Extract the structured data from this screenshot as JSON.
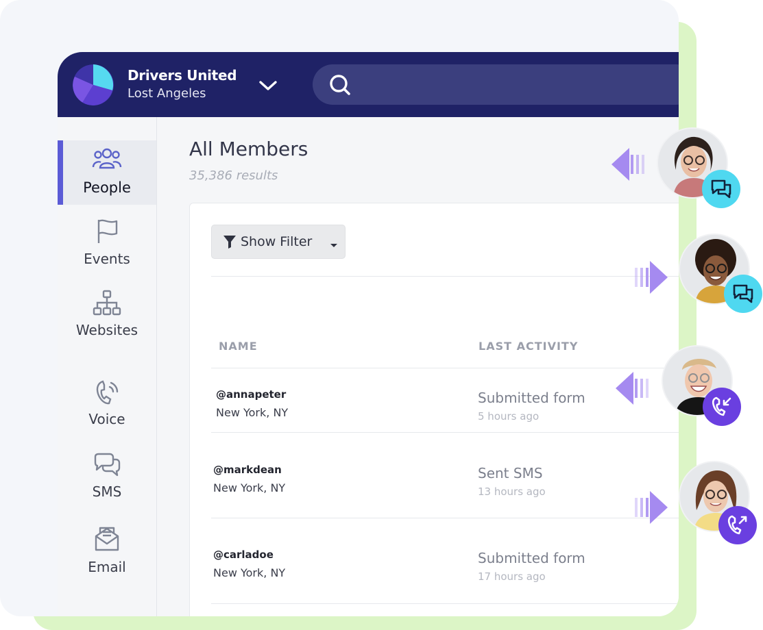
{
  "org": {
    "name": "Drivers United",
    "city": "Lost Angeles"
  },
  "search": {
    "placeholder": ""
  },
  "sidebar": {
    "items": [
      {
        "label": "People",
        "icon": "people-icon",
        "active": true
      },
      {
        "label": "Events",
        "icon": "flag-icon",
        "active": false
      },
      {
        "label": "Websites",
        "icon": "sitemap-icon",
        "active": false
      },
      {
        "label": "Voice",
        "icon": "phone-ringing-icon",
        "active": false
      },
      {
        "label": "SMS",
        "icon": "chat-bubbles-icon",
        "active": false
      },
      {
        "label": "Email",
        "icon": "envelope-icon",
        "active": false
      }
    ]
  },
  "main": {
    "title": "All Members",
    "results": "35,386 results",
    "filter_label": "Show Filter",
    "columns": [
      "NAME",
      "LAST ACTIVITY"
    ],
    "rows": [
      {
        "handle": "@annapeter",
        "location": "New York, NY",
        "activity": "Submitted form",
        "ago": "5 hours ago"
      },
      {
        "handle": "@markdean",
        "location": "New York, NY",
        "activity": "Sent SMS",
        "ago": "13 hours ago"
      },
      {
        "handle": "@carladoe",
        "location": "New York, NY",
        "activity": "Submitted form",
        "ago": "17 hours ago"
      }
    ]
  },
  "colors": {
    "header": "#1f2266",
    "accent": "#5b5bd6",
    "chat_badge": "#4fd8f0",
    "call_badge": "#6a3fe0",
    "backdrop": "#dcf5c6"
  },
  "avatars": [
    {
      "badge": "chat-icon",
      "arrow": "left"
    },
    {
      "badge": "chat-icon",
      "arrow": "right"
    },
    {
      "badge": "incoming-call-icon",
      "arrow": "left"
    },
    {
      "badge": "outgoing-call-icon",
      "arrow": "right"
    }
  ]
}
